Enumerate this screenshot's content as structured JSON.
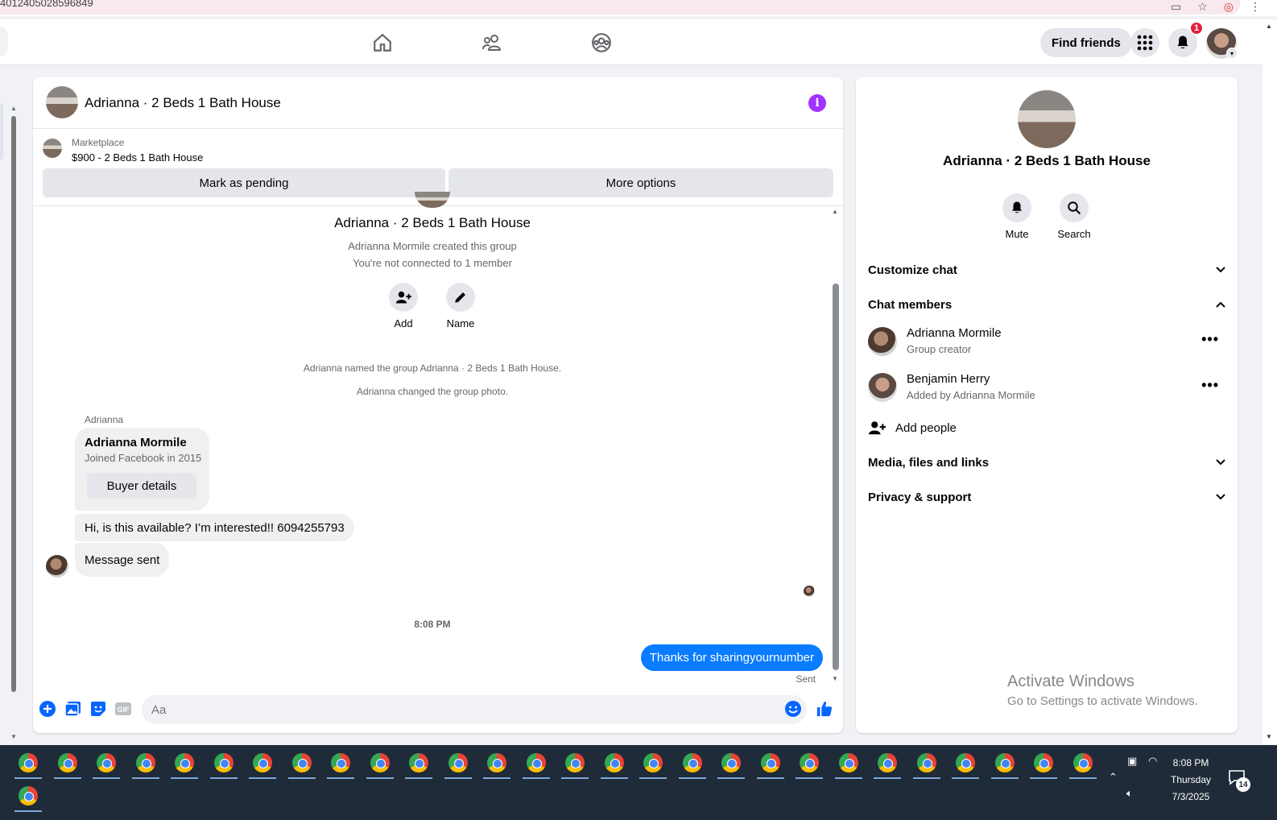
{
  "browser": {
    "url_fragment": "4012405028596849"
  },
  "topnav": {
    "find_friends_label": "Find friends",
    "notification_count": "1"
  },
  "chat": {
    "title": "Adrianna · 2 Beds 1 Bath House",
    "marketplace": {
      "label": "Marketplace",
      "listing": "$900 - 2 Beds 1 Bath House",
      "mark_pending_label": "Mark as pending",
      "more_options_label": "More options"
    },
    "intro": {
      "group_name": "Adrianna · 2 Beds 1 Bath House",
      "created_by": "Adrianna Mormile created this group",
      "connection_note": "You're not connected to 1 member",
      "add_label": "Add",
      "name_label": "Name"
    },
    "system_messages": [
      "Adrianna named the group Adrianna · 2 Beds 1 Bath House.",
      "Adrianna changed the group photo."
    ],
    "buyer_card": {
      "sender": "Adrianna",
      "name": "Adrianna Mormile",
      "joined": "Joined Facebook in 2015",
      "button": "Buyer details"
    },
    "messages_in": [
      "Hi, is this available? I’m interested!! 6094255793",
      "Message sent"
    ],
    "timestamp": "8:08 PM",
    "message_out": "Thanks for sharingyournumber",
    "status": "Sent",
    "composer_placeholder": "Aa"
  },
  "info_panel": {
    "title": "Adrianna · 2 Beds 1 Bath House",
    "mute_label": "Mute",
    "search_label": "Search",
    "customize_chat": "Customize chat",
    "chat_members": "Chat members",
    "members": [
      {
        "name": "Adrianna Mormile",
        "role": "Group creator"
      },
      {
        "name": "Benjamin Herry",
        "role": "Added by Adrianna Mormile"
      }
    ],
    "add_people": "Add people",
    "media_files_links": "Media, files and links",
    "privacy_support": "Privacy & support"
  },
  "watermark": {
    "line1": "Activate Windows",
    "line2": "Go to Settings to activate Windows."
  },
  "taskbar": {
    "time": "8:08 PM",
    "day": "Thursday",
    "date": "7/3/2025",
    "notification_count": "14"
  }
}
